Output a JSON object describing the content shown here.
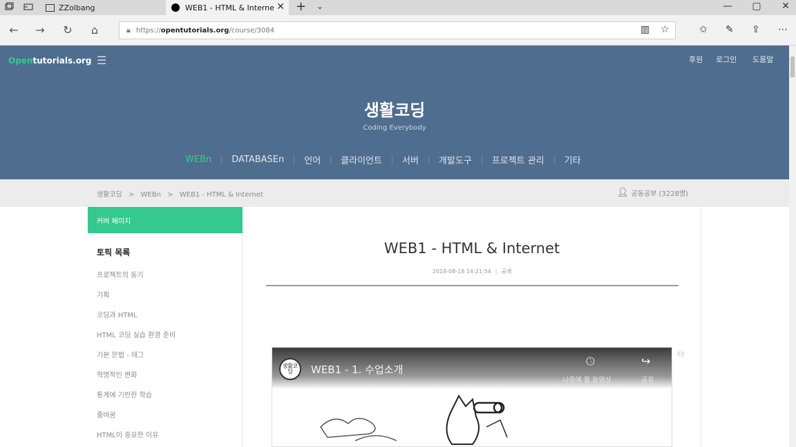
{
  "browser": {
    "inactive_tab": "ZZolbang",
    "active_tab": "WEB1 - HTML & Interne",
    "tab_close": "✕",
    "new_tab": "+",
    "tab_menu": "⌄",
    "url_prefix": "https://",
    "url_domain": "opentutorials.org",
    "url_path": "/course/3084",
    "win_min": "—",
    "win_max": "▢",
    "win_close": "✕"
  },
  "site": {
    "logo_accent": "Open",
    "logo_rest": "tutorials.org",
    "header_links": [
      "후원",
      "로그인",
      "도움말"
    ],
    "title": "생활코딩",
    "subtitle": "Coding Everybody",
    "categories": [
      "WEBn",
      "DATABASEn",
      "언어",
      "클라이언트",
      "서버",
      "개발도구",
      "프로젝트 관리",
      "기타"
    ],
    "active_category": "WEBn"
  },
  "breadcrumb": {
    "items": [
      "생활코딩",
      ">",
      "WEBn",
      ">",
      "WEB1 - HTML & Internet"
    ],
    "study_label": "공동공부 (3228명)"
  },
  "sidebar": {
    "cover": "커버 페이지",
    "toc_title": "토픽 목록",
    "items": [
      "프로젝트의 동기",
      "기획",
      "코딩과 HTML",
      "HTML 코딩 실습 환경 준비",
      "기본 문법 - 태그",
      "혁명적인 변화",
      "통계에 기반한 학습",
      "줄바꿈",
      "HTML이 중요한 이유"
    ]
  },
  "content": {
    "title": "WEB1 - HTML & Internet",
    "date": "2018-08-18 14:21:54",
    "separator": "|",
    "visibility": "공개",
    "video": {
      "channel": "생활코딩",
      "title": "WEB1 - 1. 수업소개",
      "watch_later": "나중에 볼 동영상",
      "share": "공유"
    }
  },
  "colors": {
    "header_bg": "#4f6d8e",
    "accent_green": "#36c98e",
    "crumb_bg": "#ececec"
  }
}
